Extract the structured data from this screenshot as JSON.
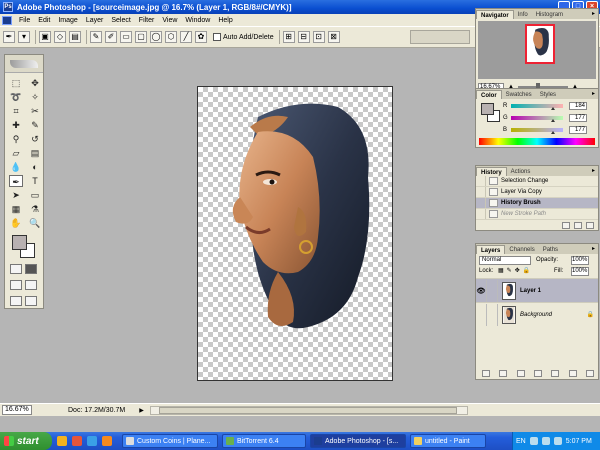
{
  "window": {
    "title": "Adobe Photoshop - [sourceimage.jpg @ 16.7% (Layer 1, RGB/8#/CMYK)]",
    "app_icon": "photoshop-icon"
  },
  "menu": [
    "File",
    "Edit",
    "Image",
    "Layer",
    "Select",
    "Filter",
    "View",
    "Window",
    "Help"
  ],
  "options_bar": {
    "auto_add_delete_label": "Auto Add/Delete"
  },
  "status": {
    "zoom": "16.67%",
    "doc": "Doc: 17.2M/30.7M"
  },
  "navigator": {
    "tabs": [
      "Navigator",
      "Info",
      "Histogram"
    ],
    "zoom": "16.67%"
  },
  "color_panel": {
    "tabs": [
      "Color",
      "Swatches",
      "Styles"
    ],
    "channels": [
      {
        "label": "R",
        "value": "184"
      },
      {
        "label": "G",
        "value": "177"
      },
      {
        "label": "B",
        "value": "177"
      }
    ],
    "foreground": "#b8b1b1",
    "background": "#ffffff"
  },
  "history": {
    "tabs": [
      "History",
      "Actions"
    ],
    "items": [
      "Selection Change",
      "Layer Via Copy",
      "History Brush",
      "New Stroke Path"
    ]
  },
  "layers": {
    "tabs": [
      "Layers",
      "Channels",
      "Paths"
    ],
    "blend_mode": "Normal",
    "opacity_label": "Opacity:",
    "opacity": "100%",
    "lock_label": "Lock:",
    "fill_label": "Fill:",
    "fill": "100%",
    "items": [
      {
        "name": "Layer 1"
      },
      {
        "name": "Background"
      }
    ]
  },
  "taskbar": {
    "start": "start",
    "tasks": [
      "Custom Coins | Plane...",
      "BitTorrent 6.4",
      "Adobe Photoshop - [s...",
      "untitled - Paint"
    ],
    "lang": "EN",
    "time": "5:07 PM"
  }
}
